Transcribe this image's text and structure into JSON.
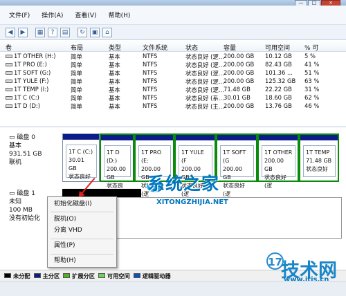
{
  "menu": [
    "文件(F)",
    "操作(A)",
    "查看(V)",
    "帮助(H)"
  ],
  "columns": [
    "卷",
    "布局",
    "类型",
    "文件系统",
    "状态",
    "容量",
    "可用空间",
    "% 可"
  ],
  "volumes": [
    [
      "1T OTHER (H:)",
      "简单",
      "基本",
      "NTFS",
      "状态良好 (逻...",
      "200.00 GB",
      "10.12 GB",
      "5 %"
    ],
    [
      "1T PRO (E:)",
      "简单",
      "基本",
      "NTFS",
      "状态良好 (逻...",
      "200.00 GB",
      "82.43 GB",
      "41 %"
    ],
    [
      "1T SOFT (G:)",
      "简单",
      "基本",
      "NTFS",
      "状态良好 (逻...",
      "200.00 GB",
      "101.36 ...",
      "51 %"
    ],
    [
      "1T YULE (F:)",
      "简单",
      "基本",
      "NTFS",
      "状态良好 (逻...",
      "200.00 GB",
      "125.32 GB",
      "63 %"
    ],
    [
      "1T TEMP (I:)",
      "简单",
      "基本",
      "NTFS",
      "状态良好 (逻...",
      "71.48 GB",
      "22.22 GB",
      "31 %"
    ],
    [
      "1T C (C:)",
      "简单",
      "基本",
      "NTFS",
      "状态良好 (系...",
      "30.01 GB",
      "18.60 GB",
      "62 %"
    ],
    [
      "1T D (D:)",
      "简单",
      "基本",
      "NTFS",
      "状态良好 (主...",
      "200.00 GB",
      "13.76 GB",
      "46 %"
    ]
  ],
  "disk0": {
    "name": "磁盘 0",
    "lines": [
      "基本",
      "931.51 GB",
      "联机"
    ]
  },
  "disk0_partitions": [
    [
      "1T C  (C:)",
      "30.01 GB",
      "状态良好"
    ],
    [
      "1T D  (D:)",
      "200.00 GB",
      "状态良好"
    ],
    [
      "1T PRO  (E:",
      "200.00 GB",
      "状态良好 (逻"
    ],
    [
      "1T YULE  (F",
      "200.00 GB",
      "状态良好 (逻"
    ],
    [
      "1T SOFT  (G",
      "200.00 GB",
      "状态良好 (逻"
    ],
    [
      "1T OTHER",
      "200.00 GB",
      "状态良好 (逻"
    ],
    [
      "1T TEMP",
      "71.48 GB",
      "状态良好"
    ]
  ],
  "disk1": {
    "name": "磁盘 1",
    "lines": [
      "未知",
      "100 MB",
      "没有初始化"
    ]
  },
  "context_menu": [
    "初始化磁盘(I)",
    "脱机(O)",
    "分离 VHD",
    "属性(P)",
    "帮助(H)"
  ],
  "legend": [
    "未分配",
    "主分区",
    "扩展分区",
    "可用空间",
    "逻辑驱动器"
  ],
  "legend_colors": [
    "#000000",
    "#0b1d8a",
    "#55b11d",
    "#6ad35b",
    "#0f4fc4"
  ],
  "watermarks": {
    "logo_text": "系统之家",
    "logo_url": "XITONGZHIJIA.NET",
    "site_text": "技术网",
    "site_url": "www.itjs.cn",
    "site_badge": "17"
  }
}
